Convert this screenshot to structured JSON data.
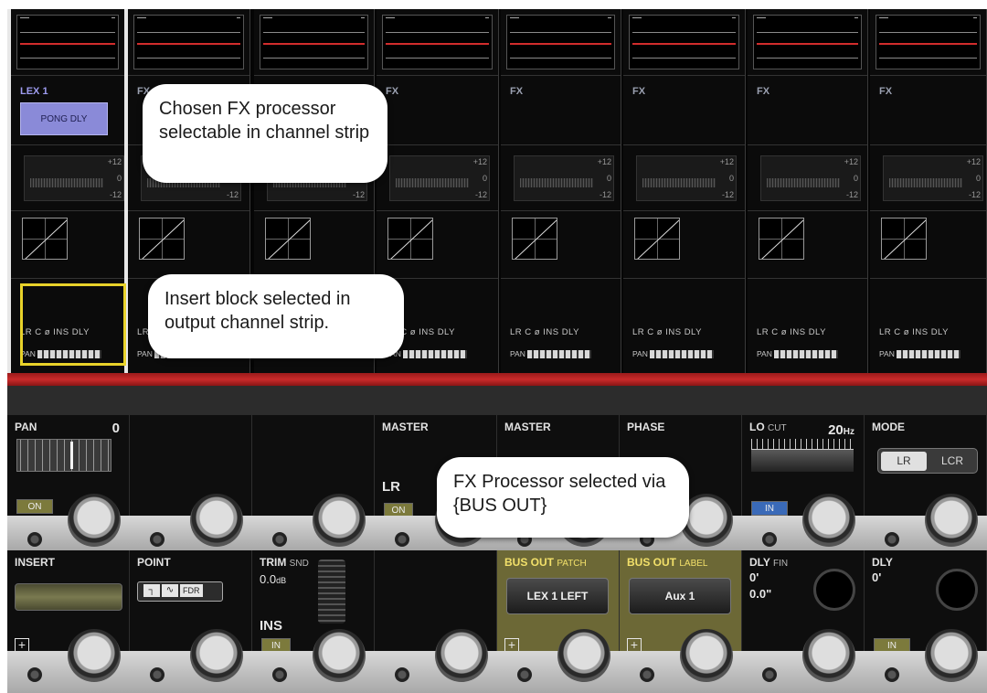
{
  "strips": [
    {
      "fx_label": "LEX 1",
      "fx_button": "PONG DLY",
      "active": true
    },
    {
      "fx_label": "FX"
    },
    {
      "fx_label": "FX"
    },
    {
      "fx_label": "FX"
    },
    {
      "fx_label": "FX"
    },
    {
      "fx_label": "FX"
    },
    {
      "fx_label": "FX"
    },
    {
      "fx_label": "FX"
    }
  ],
  "eq_scale": {
    "top": "+12",
    "mid": "0",
    "bottom": "-12"
  },
  "route_row": "LR C ø INS DLY",
  "pan_label": "PAN",
  "callouts": {
    "fx_processor": "Chosen FX processor selectable in channel strip",
    "insert_block": "Insert block selected in output channel strip.",
    "bus_out": "FX Processor selected via {BUS OUT}"
  },
  "controls": {
    "pan": {
      "title": "PAN",
      "value": "0",
      "on_label": "ON"
    },
    "master1": {
      "title": "MASTER",
      "value": "LR",
      "on_label": "ON"
    },
    "master2": {
      "title": "MASTER"
    },
    "phase": {
      "title": "PHASE"
    },
    "lo_cut": {
      "title": "LO",
      "sub": "CUT",
      "value": "20",
      "unit": "Hz",
      "in_label": "IN"
    },
    "mode": {
      "title": "MODE",
      "opt1": "LR",
      "opt2": "LCR"
    },
    "insert": {
      "title": "INSERT"
    },
    "point": {
      "title": "POINT",
      "seg1": "┐",
      "seg2": "∿",
      "fdr": "FDR"
    },
    "trim": {
      "title": "TRIM",
      "sub": "SND",
      "value": "0.0",
      "unit": "dB",
      "ins": "INS",
      "in_label": "IN"
    },
    "bus_patch": {
      "title": "BUS OUT",
      "sub": "PATCH",
      "button": "LEX 1 LEFT"
    },
    "bus_label": {
      "title": "BUS OUT",
      "sub": "LABEL",
      "button": "Aux 1"
    },
    "dly_fin": {
      "title": "DLY",
      "sub": "FIN",
      "value1": "0'",
      "value2": "0.0\""
    },
    "dly": {
      "title": "DLY",
      "value": "0'",
      "in_label": "IN"
    }
  },
  "colors": {
    "accent_red": "#c92a2a",
    "fx_button": "#8a8ad8",
    "selection": "#e8d22a",
    "highlight_cell": "#6c6836"
  }
}
